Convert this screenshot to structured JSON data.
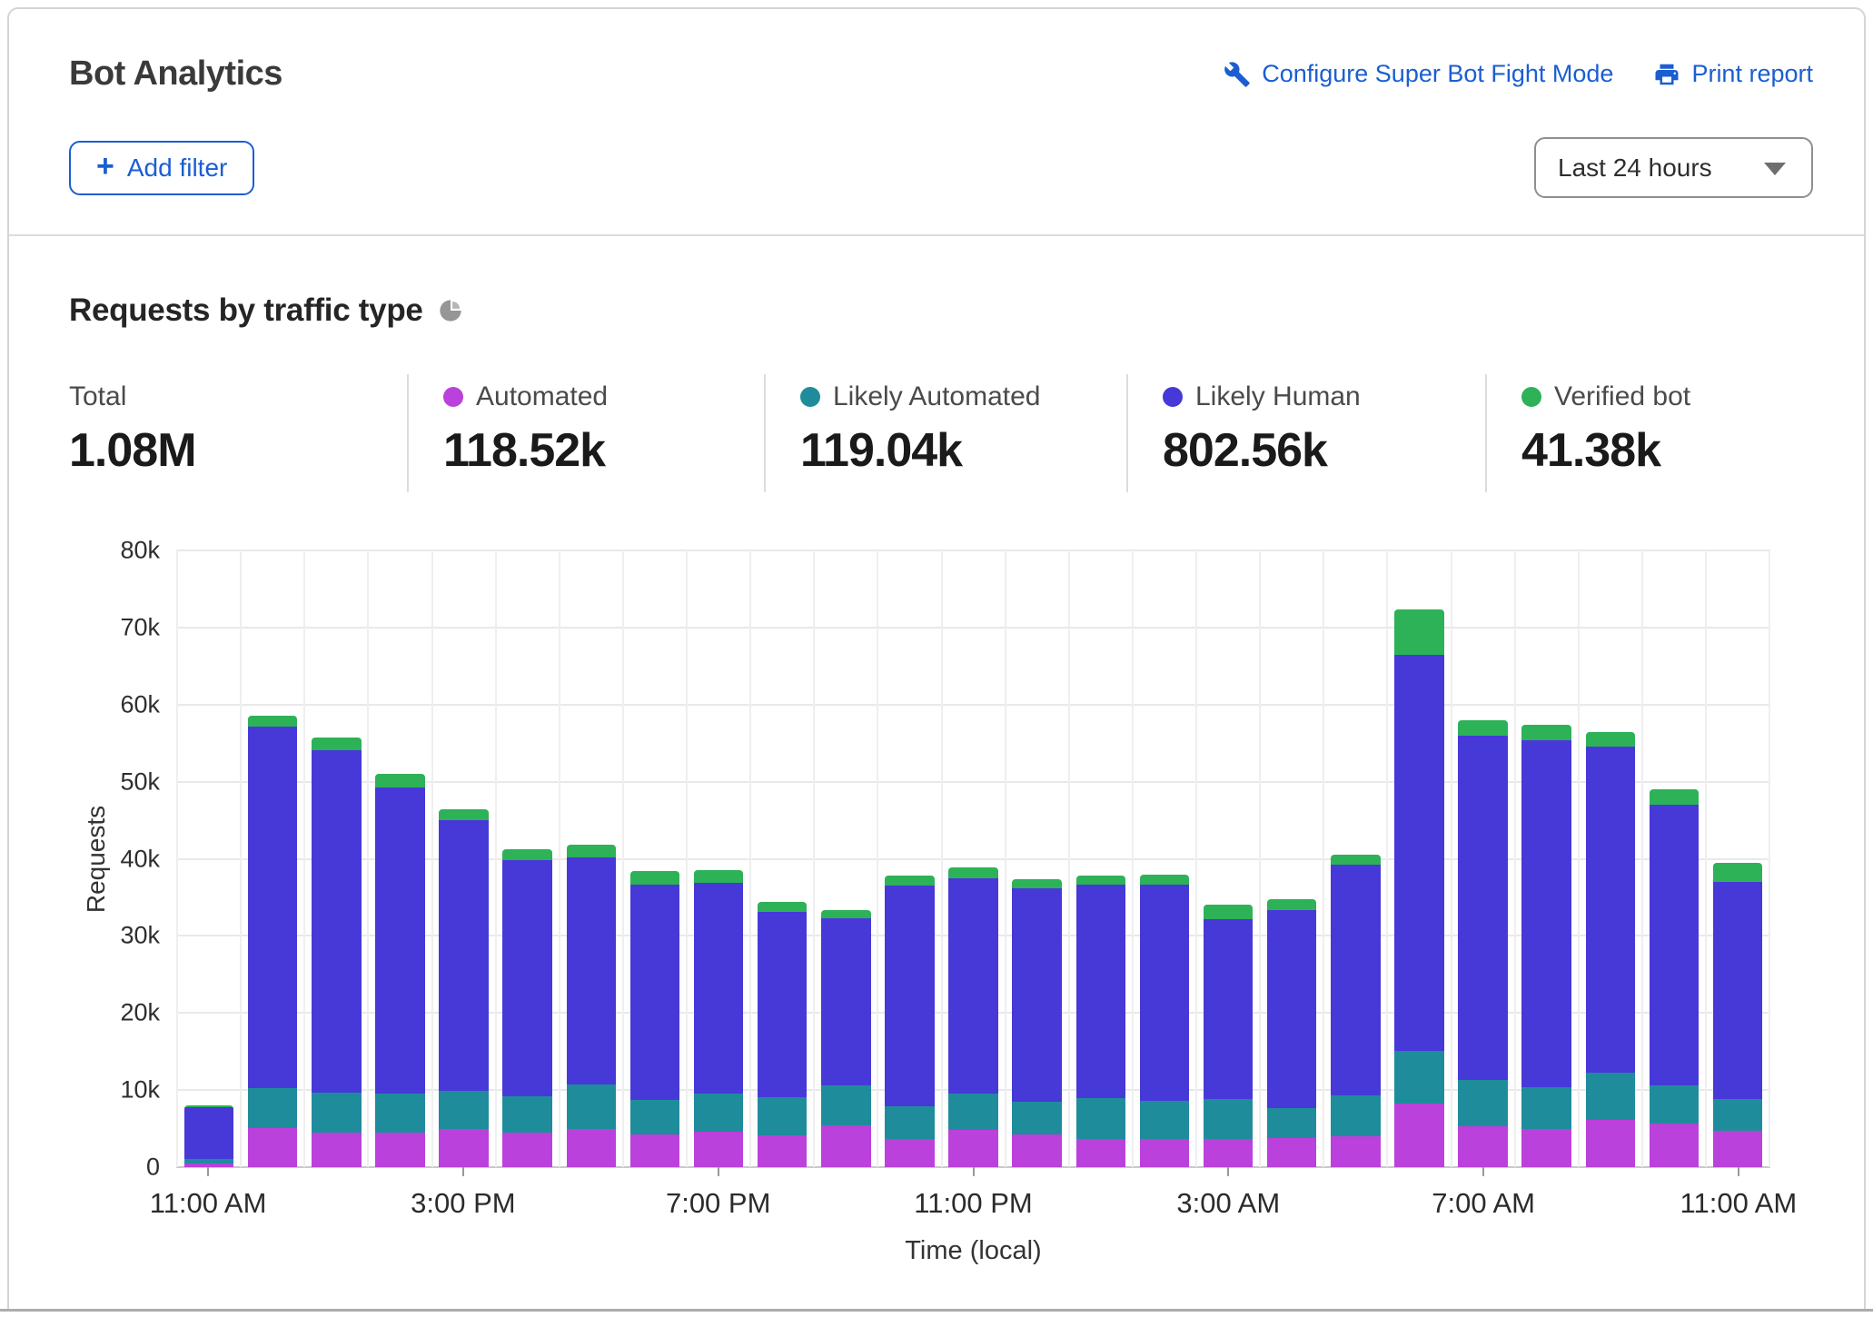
{
  "header": {
    "title": "Bot Analytics",
    "configure_link": "Configure Super Bot Fight Mode",
    "print_link": "Print report",
    "add_filter_label": "Add filter",
    "plus_glyph": "+",
    "time_range_value": "Last 24 hours"
  },
  "section": {
    "title": "Requests by traffic type"
  },
  "stats": [
    {
      "id": "total",
      "label": "Total",
      "value": "1.08M",
      "color": null
    },
    {
      "id": "automated",
      "label": "Automated",
      "value": "118.52k",
      "color": "#ba41db"
    },
    {
      "id": "likely_automated",
      "label": "Likely Automated",
      "value": "119.04k",
      "color": "#1f8c9c"
    },
    {
      "id": "likely_human",
      "label": "Likely Human",
      "value": "802.56k",
      "color": "#4639d8"
    },
    {
      "id": "verified_bot",
      "label": "Verified bot",
      "value": "41.38k",
      "color": "#2db258"
    }
  ],
  "chart_data": {
    "type": "bar",
    "stacked": true,
    "title": "Requests by traffic type",
    "xlabel": "Time (local)",
    "ylabel": "Requests",
    "ylim": [
      0,
      80000
    ],
    "yticks": [
      "80k",
      "70k",
      "60k",
      "50k",
      "40k",
      "30k",
      "20k",
      "10k",
      "0"
    ],
    "grid": true,
    "x_tick_indices": [
      0,
      4,
      8,
      12,
      16,
      20,
      24
    ],
    "x_tick_labels": [
      "11:00 AM",
      "3:00 PM",
      "7:00 PM",
      "11:00 PM",
      "3:00 AM",
      "7:00 AM",
      "11:00 AM"
    ],
    "categories": [
      "11:00 AM",
      "12:00 PM",
      "1:00 PM",
      "2:00 PM",
      "3:00 PM",
      "4:00 PM",
      "5:00 PM",
      "6:00 PM",
      "7:00 PM",
      "8:00 PM",
      "9:00 PM",
      "10:00 PM",
      "11:00 PM",
      "12:00 AM",
      "1:00 AM",
      "2:00 AM",
      "3:00 AM",
      "4:00 AM",
      "5:00 AM",
      "6:00 AM",
      "7:00 AM",
      "8:00 AM",
      "9:00 AM",
      "10:00 AM",
      "11:00 AM"
    ],
    "series": [
      {
        "id": "automated",
        "name": "Automated",
        "color": "#ba41db",
        "values": [
          500,
          5100,
          4500,
          4500,
          5000,
          4500,
          4900,
          4200,
          4600,
          4100,
          5400,
          3600,
          4800,
          4200,
          3600,
          3700,
          3700,
          3800,
          4000,
          8300,
          5300,
          5000,
          6100,
          5600,
          4700
        ]
      },
      {
        "id": "likely_automated",
        "name": "Likely Automated",
        "color": "#1f8c9c",
        "values": [
          600,
          5200,
          5200,
          5000,
          4900,
          4700,
          5800,
          4500,
          4900,
          5000,
          5200,
          4300,
          4700,
          4300,
          5400,
          4900,
          5100,
          3900,
          5300,
          6800,
          6000,
          5400,
          6100,
          5000,
          4100
        ]
      },
      {
        "id": "likely_human",
        "name": "Likely Human",
        "color": "#4639d8",
        "values": [
          6700,
          46900,
          44400,
          39800,
          35100,
          30600,
          29500,
          28000,
          27400,
          24000,
          21700,
          28600,
          28000,
          27700,
          27700,
          28000,
          23400,
          25700,
          29900,
          51300,
          44700,
          45000,
          42300,
          36400,
          28200
        ]
      },
      {
        "id": "verified_bot",
        "name": "Verified bot",
        "color": "#2db258",
        "values": [
          200,
          1400,
          1600,
          1700,
          1400,
          1500,
          1600,
          1700,
          1600,
          1300,
          1100,
          1300,
          1400,
          1100,
          1100,
          1300,
          1900,
          1400,
          1300,
          6000,
          2000,
          2000,
          1900,
          2000,
          2500
        ]
      }
    ]
  }
}
